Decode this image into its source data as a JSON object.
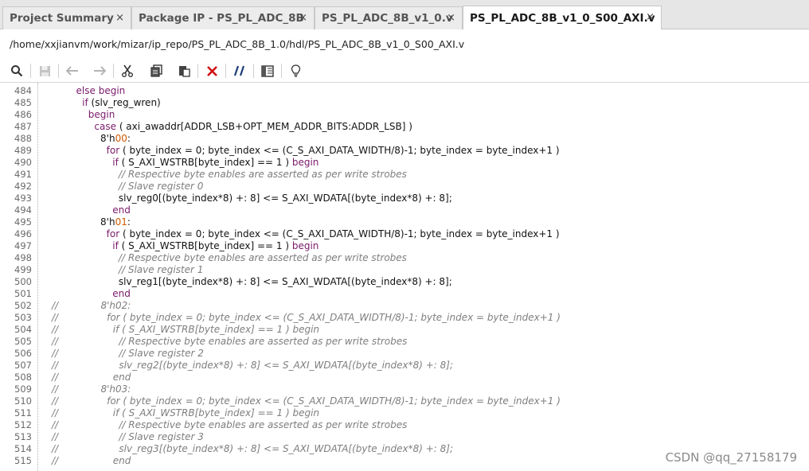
{
  "tabs": [
    {
      "label": "Project Summary",
      "close": "×"
    },
    {
      "label": "Package IP - PS_PL_ADC_8B",
      "close": "×"
    },
    {
      "label": "PS_PL_ADC_8B_v1_0.v",
      "close": "×"
    },
    {
      "label": "PS_PL_ADC_8B_v1_0_S00_AXI.v",
      "close": "×"
    }
  ],
  "path": "/home/xxjianvm/work/mizar/ip_repo/PS_PL_ADC_8B_1.0/hdl/PS_PL_ADC_8B_v1_0_S00_AXI.v",
  "toolbar": {
    "icons": [
      "search-icon",
      "save-icon",
      "undo-icon",
      "redo-icon",
      "cut-icon",
      "copy-icon",
      "paste-icon",
      "delete-icon",
      "comment-icon",
      "columns-icon",
      "lightbulb-icon"
    ]
  },
  "editor": {
    "lines": [
      {
        "n": "484",
        "segs": [
          [
            "        ",
            ""
          ],
          [
            "else",
            "kw"
          ],
          [
            " ",
            ""
          ],
          [
            "begin",
            "kw"
          ]
        ]
      },
      {
        "n": "485",
        "segs": [
          [
            "          ",
            ""
          ],
          [
            "if",
            "kw"
          ],
          [
            " (slv_reg_wren)",
            ""
          ]
        ]
      },
      {
        "n": "486",
        "segs": [
          [
            "            ",
            ""
          ],
          [
            "begin",
            "kw"
          ]
        ]
      },
      {
        "n": "487",
        "segs": [
          [
            "              ",
            ""
          ],
          [
            "case",
            "kw"
          ],
          [
            " ( axi_awaddr[ADDR_LSB+OPT_MEM_ADDR_BITS:ADDR_LSB] )",
            ""
          ]
        ]
      },
      {
        "n": "488",
        "segs": [
          [
            "                8'h",
            ""
          ],
          [
            "00",
            "num"
          ],
          [
            ":",
            ""
          ]
        ]
      },
      {
        "n": "489",
        "segs": [
          [
            "                  ",
            ""
          ],
          [
            "for",
            "kw"
          ],
          [
            " ( byte_index = 0; byte_index <= (C_S_AXI_DATA_WIDTH/8)-1; byte_index = byte_index+1 )",
            ""
          ]
        ]
      },
      {
        "n": "490",
        "segs": [
          [
            "                    ",
            ""
          ],
          [
            "if",
            "kw"
          ],
          [
            " ( S_AXI_WSTRB[byte_index] == 1 ) ",
            ""
          ],
          [
            "begin",
            "kw"
          ]
        ]
      },
      {
        "n": "491",
        "segs": [
          [
            "                      ",
            ""
          ],
          [
            "// Respective byte enables are asserted as per write strobes",
            "cmt"
          ]
        ]
      },
      {
        "n": "492",
        "segs": [
          [
            "                      ",
            ""
          ],
          [
            "// Slave register 0",
            "cmt"
          ]
        ]
      },
      {
        "n": "493",
        "segs": [
          [
            "                      slv_reg0[(byte_index*8) +: 8] <= S_AXI_WDATA[(byte_index*8) +: 8];",
            ""
          ]
        ]
      },
      {
        "n": "494",
        "segs": [
          [
            "                    ",
            ""
          ],
          [
            "end",
            "kw"
          ]
        ]
      },
      {
        "n": "495",
        "segs": [
          [
            "                8'h",
            ""
          ],
          [
            "01",
            "num"
          ],
          [
            ":",
            ""
          ]
        ]
      },
      {
        "n": "496",
        "segs": [
          [
            "                  ",
            ""
          ],
          [
            "for",
            "kw"
          ],
          [
            " ( byte_index = 0; byte_index <= (C_S_AXI_DATA_WIDTH/8)-1; byte_index = byte_index+1 )",
            ""
          ]
        ]
      },
      {
        "n": "497",
        "segs": [
          [
            "                    ",
            ""
          ],
          [
            "if",
            "kw"
          ],
          [
            " ( S_AXI_WSTRB[byte_index] == 1 ) ",
            ""
          ],
          [
            "begin",
            "kw"
          ]
        ]
      },
      {
        "n": "498",
        "segs": [
          [
            "                      ",
            ""
          ],
          [
            "// Respective byte enables are asserted as per write strobes",
            "cmt"
          ]
        ]
      },
      {
        "n": "499",
        "segs": [
          [
            "                      ",
            ""
          ],
          [
            "// Slave register 1",
            "cmt"
          ]
        ]
      },
      {
        "n": "500",
        "segs": [
          [
            "                      slv_reg1[(byte_index*8) +: 8] <= S_AXI_WDATA[(byte_index*8) +: 8];",
            ""
          ]
        ]
      },
      {
        "n": "501",
        "segs": [
          [
            "                    ",
            ""
          ],
          [
            "end",
            "kw"
          ]
        ]
      },
      {
        "n": "502",
        "segs": [
          [
            "//              8'h02:",
            "cm"
          ]
        ]
      },
      {
        "n": "503",
        "segs": [
          [
            "//                for ( byte_index = 0; byte_index <= (C_S_AXI_DATA_WIDTH/8)-1; byte_index = byte_index+1 )",
            "cm"
          ]
        ]
      },
      {
        "n": "504",
        "segs": [
          [
            "//                  if ( S_AXI_WSTRB[byte_index] == 1 ) begin",
            "cm"
          ]
        ]
      },
      {
        "n": "505",
        "segs": [
          [
            "//                    // Respective byte enables are asserted as per write strobes",
            "cm"
          ]
        ]
      },
      {
        "n": "506",
        "segs": [
          [
            "//                    // Slave register 2",
            "cm"
          ]
        ]
      },
      {
        "n": "507",
        "segs": [
          [
            "//                    slv_reg2[(byte_index*8) +: 8] <= S_AXI_WDATA[(byte_index*8) +: 8];",
            "cm"
          ]
        ]
      },
      {
        "n": "508",
        "segs": [
          [
            "//                  end",
            "cm"
          ]
        ]
      },
      {
        "n": "509",
        "segs": [
          [
            "//              8'h03:",
            "cm"
          ]
        ]
      },
      {
        "n": "510",
        "segs": [
          [
            "//                for ( byte_index = 0; byte_index <= (C_S_AXI_DATA_WIDTH/8)-1; byte_index = byte_index+1 )",
            "cm"
          ]
        ]
      },
      {
        "n": "511",
        "segs": [
          [
            "//                  if ( S_AXI_WSTRB[byte_index] == 1 ) begin",
            "cm"
          ]
        ]
      },
      {
        "n": "512",
        "segs": [
          [
            "//                    // Respective byte enables are asserted as per write strobes",
            "cm"
          ]
        ]
      },
      {
        "n": "513",
        "segs": [
          [
            "//                    // Slave register 3",
            "cm"
          ]
        ]
      },
      {
        "n": "514",
        "segs": [
          [
            "//                    slv_reg3[(byte_index*8) +: 8] <= S_AXI_WDATA[(byte_index*8) +: 8];",
            "cm"
          ]
        ]
      },
      {
        "n": "515",
        "segs": [
          [
            "//                  end",
            "cm"
          ]
        ]
      }
    ]
  },
  "watermark": "CSDN @qq_27158179"
}
